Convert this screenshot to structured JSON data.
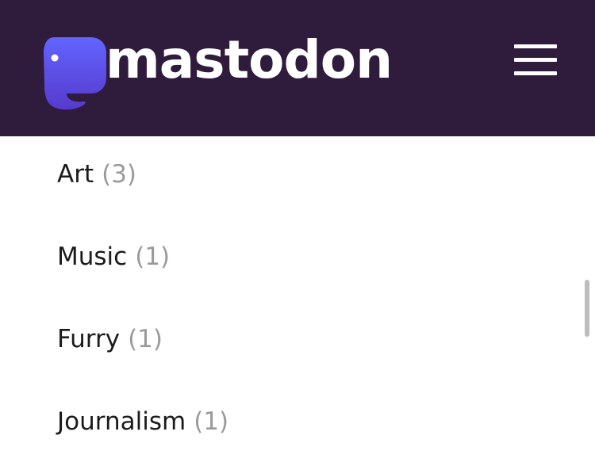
{
  "header": {
    "logo_text": "mastodon",
    "colors": {
      "background": "#2f1b3c",
      "logo_mark": "#6364ff",
      "text": "#ffffff"
    },
    "menu_icon": "hamburger-menu-icon"
  },
  "categories": [
    {
      "name": "Art",
      "count": "(3)"
    },
    {
      "name": "Music",
      "count": "(1)"
    },
    {
      "name": "Furry",
      "count": "(1)"
    },
    {
      "name": "Journalism",
      "count": "(1)"
    }
  ]
}
